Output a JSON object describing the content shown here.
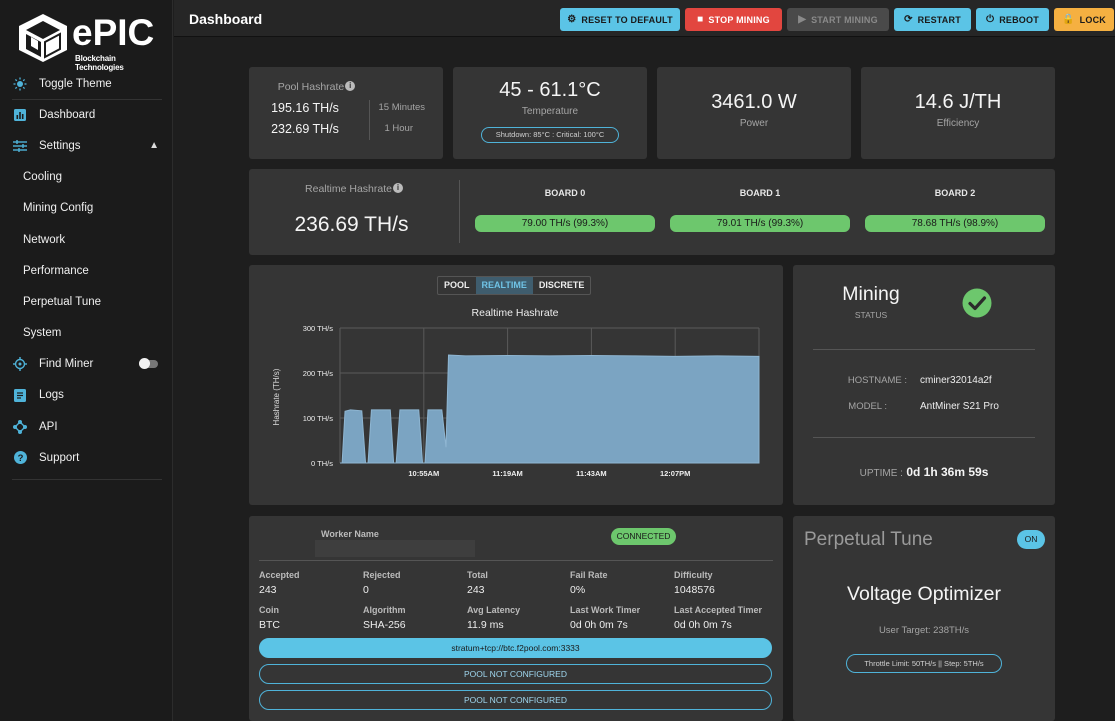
{
  "brand": {
    "name": "ePIC",
    "tagline": "Blockchain Technologies"
  },
  "sidebar": {
    "items": [
      {
        "label": "Toggle Theme",
        "icon": "sun-icon"
      },
      {
        "label": "Dashboard",
        "icon": "chart-bar-icon"
      },
      {
        "label": "Settings",
        "icon": "sliders-icon"
      },
      {
        "label": "Cooling"
      },
      {
        "label": "Mining Config"
      },
      {
        "label": "Network"
      },
      {
        "label": "Performance"
      },
      {
        "label": "Perpetual Tune"
      },
      {
        "label": "System"
      },
      {
        "label": "Find Miner",
        "icon": "crosshair-icon"
      },
      {
        "label": "Logs",
        "icon": "document-icon"
      },
      {
        "label": "API",
        "icon": "api-icon"
      },
      {
        "label": "Support",
        "icon": "help-icon"
      }
    ]
  },
  "header": {
    "title": "Dashboard",
    "buttons": {
      "reset": "RESET TO DEFAULT",
      "stop": "STOP MINING",
      "start": "START MINING",
      "restart": "RESTART",
      "reboot": "REBOOT",
      "lock": "LOCK"
    }
  },
  "summary": {
    "pool_hashrate_title": "Pool Hashrate",
    "pool_15": "195.16 TH/s",
    "pool_15_label": "15 Minutes",
    "pool_1h": "232.69 TH/s",
    "pool_1h_label": "1 Hour",
    "temperature": "45 - 61.1°C",
    "temperature_label": "Temperature",
    "temperature_badge": "Shutdown: 85°C : Critical: 100°C",
    "power": "3461.0 W",
    "power_label": "Power",
    "efficiency": "14.6 J/TH",
    "efficiency_label": "Efficiency"
  },
  "realtime": {
    "title": "Realtime Hashrate",
    "value": "236.69 TH/s",
    "boards": [
      {
        "name": "BOARD 0",
        "value": "79.00 TH/s (99.3%)"
      },
      {
        "name": "BOARD 1",
        "value": "79.01 TH/s (99.3%)"
      },
      {
        "name": "BOARD 2",
        "value": "78.68 TH/s (98.9%)"
      }
    ]
  },
  "chart_tabs": [
    "POOL",
    "REALTIME",
    "DISCRETE"
  ],
  "chart_data": {
    "type": "area",
    "title": "Realtime Hashrate",
    "ylabel": "Hashrate (TH/s)",
    "xlabel": "",
    "ylim": [
      0,
      300
    ],
    "yticks": [
      "300 TH/s",
      "200 TH/s",
      "100 TH/s",
      "0 TH/s"
    ],
    "xticks": [
      "10:55AM",
      "11:19AM",
      "11:43AM",
      "12:07PM"
    ],
    "color": "#7ba4c2",
    "series": [
      {
        "x": [
          0.0,
          0.005,
          0.012,
          0.025,
          0.052,
          0.061,
          0.067,
          0.075,
          0.12,
          0.128,
          0.134,
          0.143,
          0.188,
          0.197,
          0.203,
          0.21,
          0.243,
          0.253,
          0.259,
          0.3,
          0.4,
          0.5,
          0.6,
          0.7,
          0.8,
          0.9,
          1.0
        ],
        "values": [
          0,
          0,
          115,
          118,
          116,
          0,
          0,
          118,
          118,
          0,
          0,
          118,
          118,
          0,
          0,
          118,
          118,
          35,
          240,
          238,
          239,
          238,
          239,
          238,
          237,
          238,
          237
        ]
      }
    ]
  },
  "mining": {
    "state": "Mining",
    "state_label": "STATUS",
    "hostname_label": "HOSTNAME :",
    "hostname": "cminer32014a2f",
    "model_label": "MODEL :",
    "model": "AntMiner S21 Pro",
    "uptime_label": "UPTIME :",
    "uptime": "0d 1h 36m 59s"
  },
  "pool": {
    "worker_label": "Worker Name",
    "connected": "CONNECTED",
    "stats": [
      {
        "label": "Accepted",
        "value": "243"
      },
      {
        "label": "Rejected",
        "value": "0"
      },
      {
        "label": "Total",
        "value": "243"
      },
      {
        "label": "Fail Rate",
        "value": "0%"
      },
      {
        "label": "Difficulty",
        "value": "1048576"
      },
      {
        "label": "Coin",
        "value": "BTC"
      },
      {
        "label": "Algorithm",
        "value": "SHA-256"
      },
      {
        "label": "Avg Latency",
        "value": "11.9 ms"
      },
      {
        "label": "Last Work Timer",
        "value": "0d 0h 0m 7s"
      },
      {
        "label": "Last Accepted Timer",
        "value": "0d 0h 0m 7s"
      }
    ],
    "url": "stratum+tcp://btc.f2pool.com:3333",
    "not_configured_1": "POOL NOT CONFIGURED",
    "not_configured_2": "POOL NOT CONFIGURED"
  },
  "tune": {
    "title": "Perpetual Tune",
    "toggle": "ON",
    "mode": "Voltage Optimizer",
    "target": "User Target: 238TH/s",
    "throttle": "Throttle Limit: 50TH/s || Step: 5TH/s"
  },
  "colors": {
    "accent": "#4fb3d9",
    "danger": "#e2463f",
    "warning": "#f5b041",
    "success": "#6dc76d",
    "card": "#353535"
  }
}
